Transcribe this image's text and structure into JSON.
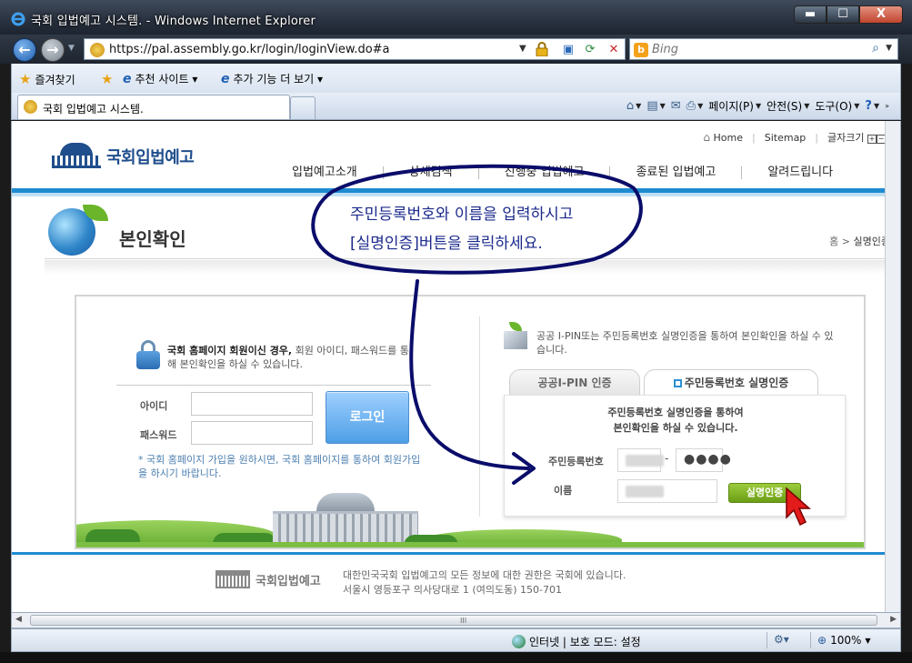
{
  "window": {
    "title": "국회 입법예고 시스템. - Windows Internet Explorer",
    "minimize": "▬",
    "maximize": "☐",
    "close": "X"
  },
  "browser": {
    "url": "https://pal.assembly.go.kr/login/loginView.do#a",
    "search_placeholder": "Bing",
    "favorites_label": "즐겨찾기",
    "fav_links": [
      "추천 사이트 ▾",
      "추가 기능 더 보기 ▾"
    ],
    "tab_label": "국회 입법예고 시스템.",
    "commands": [
      "페이지(P)",
      "안전(S)",
      "도구(O)"
    ],
    "status_zone": "인터넷 | 보호 모드: 설정",
    "zoom": "100%",
    "scroll_grip": "III"
  },
  "site": {
    "logo_text": "국회입법예고",
    "util_links": [
      "Home",
      "Sitemap",
      "글자크기"
    ],
    "gnb": [
      "입법예고소개",
      "상세검색",
      "진행중 입법예고",
      "종료된 입법예고",
      "알려드립니다"
    ],
    "page_title": "본인확인",
    "breadcrumb": [
      "홈",
      "실명인증"
    ]
  },
  "login": {
    "member_note_bold": "국회 홈페이지 회원이신 경우,",
    "member_note_rest": " 회원 아이디, 패스워드를 통해 본인확인을 하실 수 있습니다.",
    "id_label": "아이디",
    "pw_label": "패스워드",
    "login_button": "로그인",
    "join_note": "* 국회 홈페이지 가입을 원하시면, 국회 홈페이지를 통하여 회원가입을 하시기 바랍니다."
  },
  "verify": {
    "ipin_note": "공공 I-PIN또는 주민등록번호 실명인증을 통하여 본인확인을 하실 수 있습니다.",
    "tab_ipin": "공공I-PIN 인증",
    "tab_rrn": "주민등록번호 실명인증",
    "desc_line1": "주민등록번호 실명인증을 통하여",
    "desc_line2": "본인확인을 하실 수 있습니다.",
    "rrn_label": "주민등록번호",
    "rrn_dash": "-",
    "rrn_back": "●●●●",
    "name_label": "이름",
    "verify_button": "실명인증"
  },
  "annotation": {
    "line1": "주민등록번호와 이름을 입력하시고",
    "line2": "[실명인증]버튼을 클릭하세요."
  },
  "footer": {
    "logo_text": "국회입법예고",
    "line1": "대한민국국회 입법예고의 모든 정보에 대한 권한은 국회에 있습니다.",
    "line2": "서울시 영등포구 의사당대로 1 (여의도동) 150-701"
  }
}
